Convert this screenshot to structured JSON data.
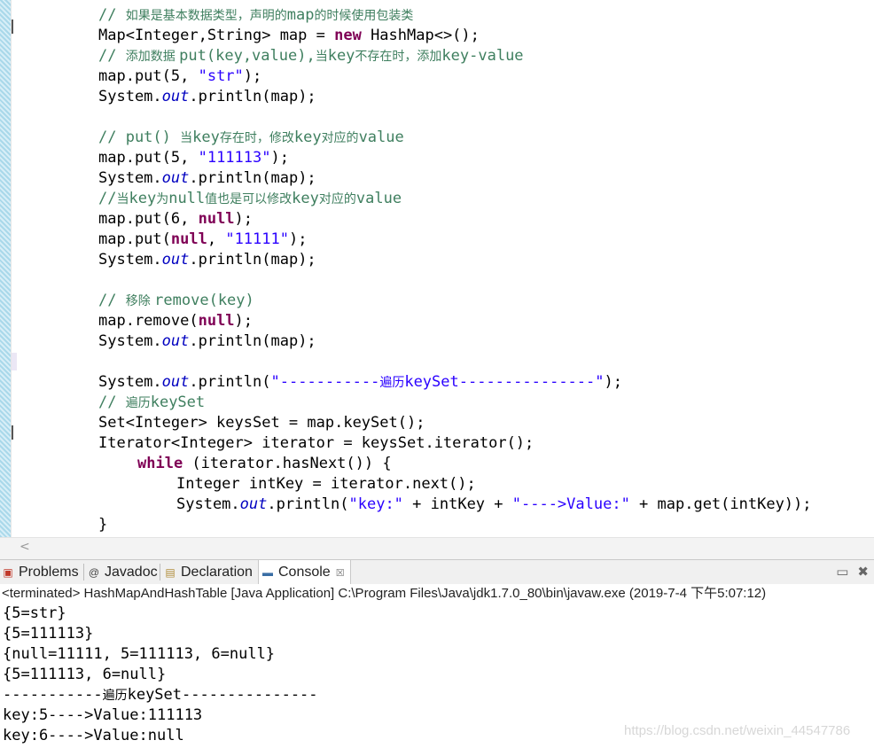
{
  "editor": {
    "l1": {
      "a": "// ",
      "b": "如果是基本数据类型，声明的",
      "c": "map",
      "d": "的时候使用包装类"
    },
    "l2": {
      "a": "Map<Integer,String> map = ",
      "kw": "new",
      "b": " HashMap<>();"
    },
    "l3": {
      "a": "// ",
      "b": "添加数据 ",
      "c": "put(key,value),",
      "d": "当",
      "e": "key",
      "f": "不存在时，添加",
      "g": "key-value"
    },
    "l4": {
      "a": "map.put(5, ",
      "s": "\"str\"",
      "b": ");"
    },
    "l5": {
      "a": "System.",
      "f": "out",
      "b": ".println(map);"
    },
    "l6": {
      "a": "// put() ",
      "b": "当",
      "c": "key",
      "d": "存在时，修改",
      "e": "key",
      "f": "对应的",
      "g": "value"
    },
    "l7": {
      "a": "map.put(5, ",
      "s": "\"111113\"",
      "b": ");"
    },
    "l8": {
      "a": "System.",
      "f": "out",
      "b": ".println(map);"
    },
    "l9": {
      "a": "//",
      "b": "当",
      "c": "key",
      "d": "为",
      "e": "null",
      "f": "值也是可以修改",
      "g": "key",
      "h": "对应的",
      "i": "value"
    },
    "l10": {
      "a": "map.put(6, ",
      "kw": "null",
      "b": ");"
    },
    "l11": {
      "a": "map.put(",
      "kw": "null",
      "b": ", ",
      "s": "\"11111\"",
      "c": ");"
    },
    "l12": {
      "a": "System.",
      "f": "out",
      "b": ".println(map);"
    },
    "l13": {
      "a": "// ",
      "b": "移除 ",
      "c": "remove(key)"
    },
    "l14": {
      "a": "map.remove(",
      "kw": "null",
      "b": ");"
    },
    "l15": {
      "a": "System.",
      "f": "out",
      "b": ".println(map);"
    },
    "l16": {
      "a": "System.",
      "f": "out",
      "b": ".println(",
      "s1": "\"-----------",
      "s2": "遍历",
      "s3": "keySet---------------\"",
      "c": ");"
    },
    "l17": {
      "a": "// ",
      "b": "遍历",
      "c": "keySet"
    },
    "l18": {
      "a": "Set<Integer> keysSet = map.keySet();"
    },
    "l19": {
      "a": "Iterator<Integer> iterator = keysSet.iterator();"
    },
    "l20": {
      "kw": "while",
      "a": " (iterator.hasNext()) {"
    },
    "l21": {
      "a": "Integer intKey = iterator.next();"
    },
    "l22": {
      "a": "System.",
      "f": "out",
      "b": ".println(",
      "s1": "\"key:\"",
      "c": " + intKey + ",
      "s2": "\"---->Value:\"",
      "d": " + map.get(intKey));"
    },
    "l23": {
      "a": "}"
    }
  },
  "scroll": {
    "left_arrow": "<"
  },
  "tabs": [
    {
      "label": "Problems",
      "icon": "problems-icon"
    },
    {
      "label": "Javadoc",
      "icon": "at-icon",
      "glyph": "@"
    },
    {
      "label": "Declaration",
      "icon": "declaration-icon"
    },
    {
      "label": "Console",
      "icon": "console-icon",
      "active": true,
      "close": "☒"
    }
  ],
  "view_controls": {
    "minimize": "▭",
    "close": "✖"
  },
  "console": {
    "status": "<terminated> HashMapAndHashTable [Java Application] C:\\Program Files\\Java\\jdk1.7.0_80\\bin\\javaw.exe (2019-7-4 下午5:07:12)",
    "lines": [
      "{5=str}",
      "{5=111113}",
      "{null=11111, 5=111113, 6=null}",
      "{5=111113, 6=null}",
      {
        "a": "-----------",
        "b": "遍历",
        "c": "keySet---------------"
      },
      "key:5---->Value:111113",
      "key:6---->Value:null"
    ]
  },
  "watermark": "https://blog.csdn.net/weixin_44547786",
  "colors": {
    "comment": "#3f7f5f",
    "keyword": "#7f0055",
    "string": "#2a00ff",
    "field": "#0000c0"
  }
}
